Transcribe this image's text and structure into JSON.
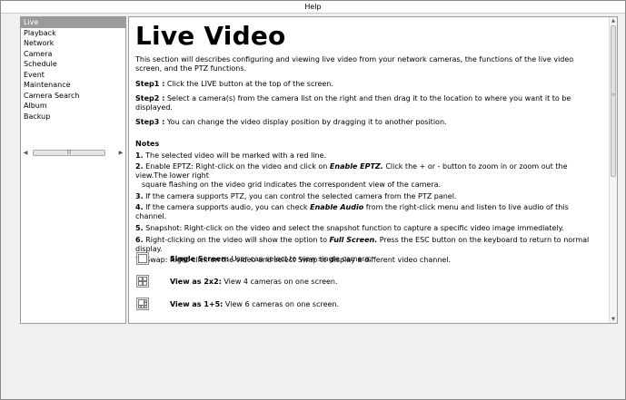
{
  "window": {
    "title": "Help"
  },
  "sidebar": {
    "items": [
      {
        "label": "Live"
      },
      {
        "label": "Playback"
      },
      {
        "label": "Network"
      },
      {
        "label": "Camera"
      },
      {
        "label": "Schedule"
      },
      {
        "label": "Event"
      },
      {
        "label": "Maintenance"
      },
      {
        "label": "Camera Search"
      },
      {
        "label": "Album"
      },
      {
        "label": "Backup"
      }
    ],
    "selected": "Live"
  },
  "content": {
    "title": "Live Video",
    "intro": "This section will describes configuring and viewing live video from your network cameras, the functions of the live video screen, and the PTZ functions.",
    "steps": [
      {
        "label": "Step1 :",
        "text": "Click the LIVE button at the top of the screen."
      },
      {
        "label": "Step2 :",
        "text": "Select a camera(s) from the camera list on the right and then drag it to the location to where you want it to be displayed."
      },
      {
        "label": "Step3 :",
        "text": "You can change the video display position by dragging it to another position."
      }
    ],
    "notes_heading": "Notes",
    "notes": [
      {
        "num": "1.",
        "pre": "The selected video will be marked with a red line.",
        "em": "",
        "post": "",
        "cont": ""
      },
      {
        "num": "2.",
        "pre": "Enable EPTZ: Right-click on the video and click on ",
        "em": "Enable EPTZ.",
        "post": " Click the + or - button to zoom in or zoom out the view.The lower right",
        "cont": "square flashing on the video grid indicates the correspondent view of the camera."
      },
      {
        "num": "3.",
        "pre": "If the camera supports PTZ, you can control the selected camera from the PTZ panel.",
        "em": "",
        "post": "",
        "cont": ""
      },
      {
        "num": "4.",
        "pre": "If the camera supports audio, you can check ",
        "em": "Enable Audio",
        "post": " from the right-click menu and listen to live audio of this channel.",
        "cont": ""
      },
      {
        "num": "5.",
        "pre": "Snapshot: Right-click on the video and select the snapshot function to capture a specific video image immediately.",
        "em": "",
        "post": "",
        "cont": ""
      },
      {
        "num": "6.",
        "pre": "Right-clicking on the video will show the option to ",
        "em": "Full Screen.",
        "post": " Press the ESC button on the keyboard to return to normal display.",
        "cont": ""
      },
      {
        "num": "7.",
        "pre": "Swap: Right-click on the video and select Swap to display a different video channel.",
        "em": "",
        "post": "",
        "cont": ""
      }
    ],
    "view_modes": [
      {
        "icon": "single-screen-icon",
        "label": "Single Screen:",
        "text": " User can select to view single camera."
      },
      {
        "icon": "grid-2x2-icon",
        "label": "View as 2x2:",
        "text": " View 4 cameras on one screen."
      },
      {
        "icon": "grid-1plus5-icon",
        "label": "View as 1+5:",
        "text": " View 6 cameras on one screen."
      }
    ]
  }
}
